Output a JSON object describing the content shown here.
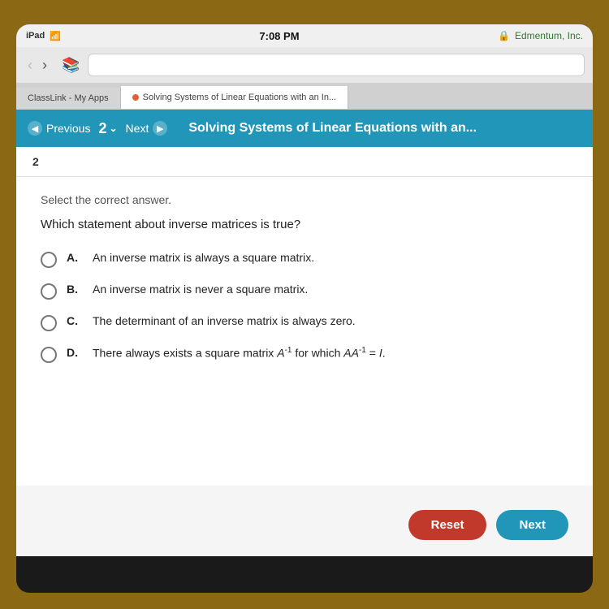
{
  "device": {
    "status_bar": {
      "left": "iPad",
      "time": "7:08 PM",
      "brand": "Edmentum, Inc.",
      "brand_label": "🔒 Edmentum, Inc."
    },
    "browser": {
      "back_enabled": false,
      "forward_enabled": true
    },
    "tabs": [
      {
        "id": "tab1",
        "label": "ClassLink - My Apps",
        "active": false
      },
      {
        "id": "tab2",
        "label": "Solving Systems of Linear Equations with an In...",
        "active": true
      }
    ]
  },
  "toolbar": {
    "prev_label": "Previous",
    "next_label": "Next",
    "question_num": "2",
    "chevron": "⌄",
    "title": "Solving Systems of Linear Equations with an..."
  },
  "question": {
    "number": "2",
    "instruction": "Select the correct answer.",
    "text": "Which statement about inverse matrices is true?",
    "options": [
      {
        "id": "A",
        "text": "An inverse matrix is always a square matrix."
      },
      {
        "id": "B",
        "text": "An inverse matrix is never a square matrix."
      },
      {
        "id": "C",
        "text": "The determinant of an inverse matrix is always zero."
      },
      {
        "id": "D",
        "text_html": true,
        "text": "There always exists a square matrix A⁻¹ for which AA⁻¹ = I."
      }
    ]
  },
  "buttons": {
    "reset_label": "Reset",
    "next_label": "Next"
  }
}
